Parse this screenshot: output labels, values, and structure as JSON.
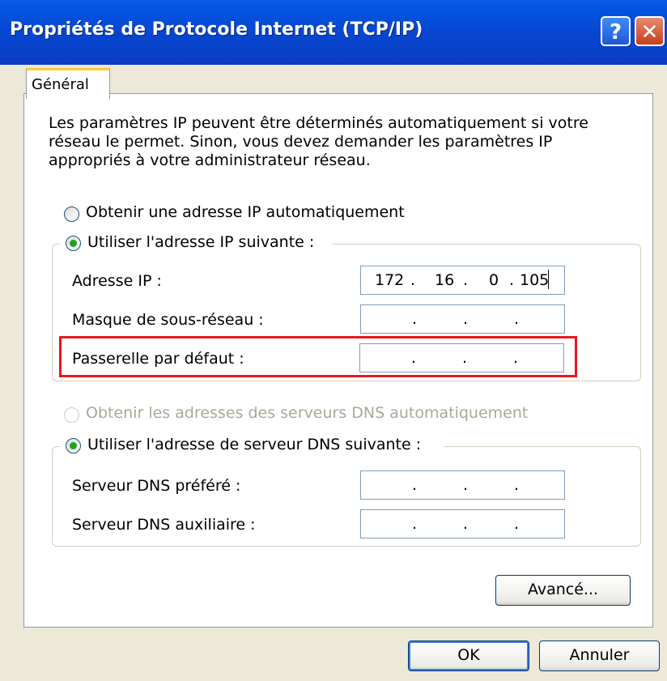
{
  "window": {
    "title": "Propriétés de Protocole Internet (TCP/IP)",
    "help_glyph": "?",
    "close_glyph": "✕"
  },
  "tabs": [
    {
      "label": "Général",
      "selected": true
    }
  ],
  "intro_text": "Les paramètres IP peuvent être déterminés automatiquement si votre réseau le permet. Sinon, vous devez demander les paramètres IP appropriés à votre administrateur réseau.",
  "ip_mode": {
    "auto_label": "Obtenir une adresse IP automatiquement",
    "manual_label": "Utiliser l'adresse IP suivante :",
    "selected": "manual"
  },
  "ip_fields": [
    {
      "label": "Adresse IP :",
      "octets": [
        "172",
        "16",
        "0",
        "105"
      ]
    },
    {
      "label": "Masque de sous-réseau :",
      "octets": [
        "",
        "",
        "",
        ""
      ]
    },
    {
      "label": "Passerelle par défaut :",
      "octets": [
        "",
        "",
        "",
        ""
      ],
      "highlighted": true
    }
  ],
  "dns_mode": {
    "auto_label": "Obtenir les adresses des serveurs DNS automatiquement",
    "auto_disabled": true,
    "manual_label": "Utiliser l'adresse de serveur DNS suivante :",
    "selected": "manual"
  },
  "dns_fields": [
    {
      "label": "Serveur DNS préféré :",
      "octets": [
        "",
        "",
        "",
        ""
      ]
    },
    {
      "label": "Serveur DNS auxiliaire :",
      "octets": [
        "",
        "",
        "",
        ""
      ]
    }
  ],
  "buttons": {
    "advanced": "Avancé...",
    "ok": "OK",
    "cancel": "Annuler"
  },
  "colors": {
    "titlebar": "#0845CF",
    "dialog_bg": "#ECE9D8",
    "highlight_box": "#E8181A",
    "radio_dot": "#21A121",
    "tab_accent": "#FFC83C"
  }
}
